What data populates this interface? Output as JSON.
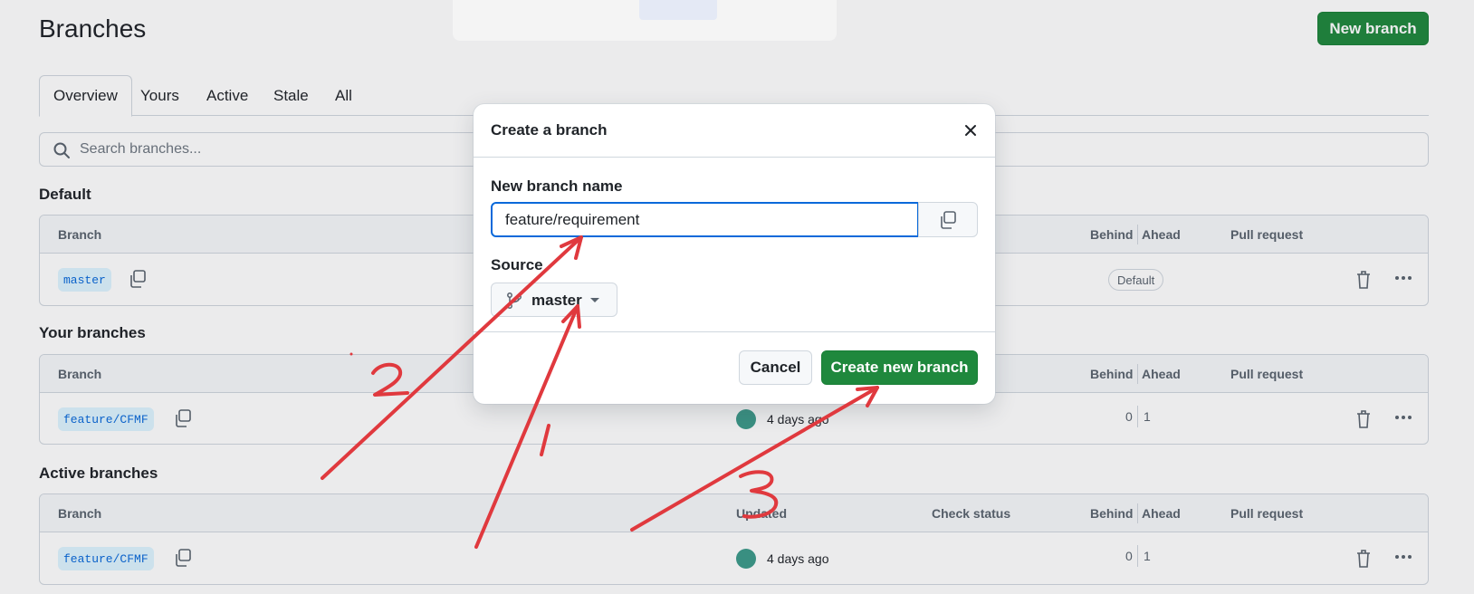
{
  "header": {
    "title": "Branches",
    "new_branch_label": "New branch"
  },
  "tabs": [
    "Overview",
    "Yours",
    "Active",
    "Stale",
    "All"
  ],
  "search": {
    "placeholder": "Search branches..."
  },
  "columns": {
    "branch": "Branch",
    "updated": "Updated",
    "check_status": "Check status",
    "behind": "Behind",
    "ahead": "Ahead",
    "pull_request": "Pull request"
  },
  "sections": {
    "default": {
      "title": "Default",
      "row": {
        "branch": "master",
        "badge": "Default"
      }
    },
    "yours": {
      "title": "Your branches",
      "row": {
        "branch": "feature/CFMF",
        "updated": "4 days ago",
        "behind": "0",
        "ahead": "1"
      }
    },
    "active": {
      "title": "Active branches",
      "row": {
        "branch": "feature/CFMF",
        "updated": "4 days ago",
        "behind": "0",
        "ahead": "1"
      }
    }
  },
  "dialog": {
    "title": "Create a branch",
    "name_label": "New branch name",
    "name_value": "feature/requirement",
    "source_label": "Source",
    "source_value": "master",
    "cancel_label": "Cancel",
    "create_label": "Create new branch"
  },
  "annotations": [
    "2",
    "1",
    "3"
  ],
  "colors": {
    "primary_green": "#1f883d",
    "accent_blue": "#0969da",
    "annotation_red": "#e0393e"
  }
}
